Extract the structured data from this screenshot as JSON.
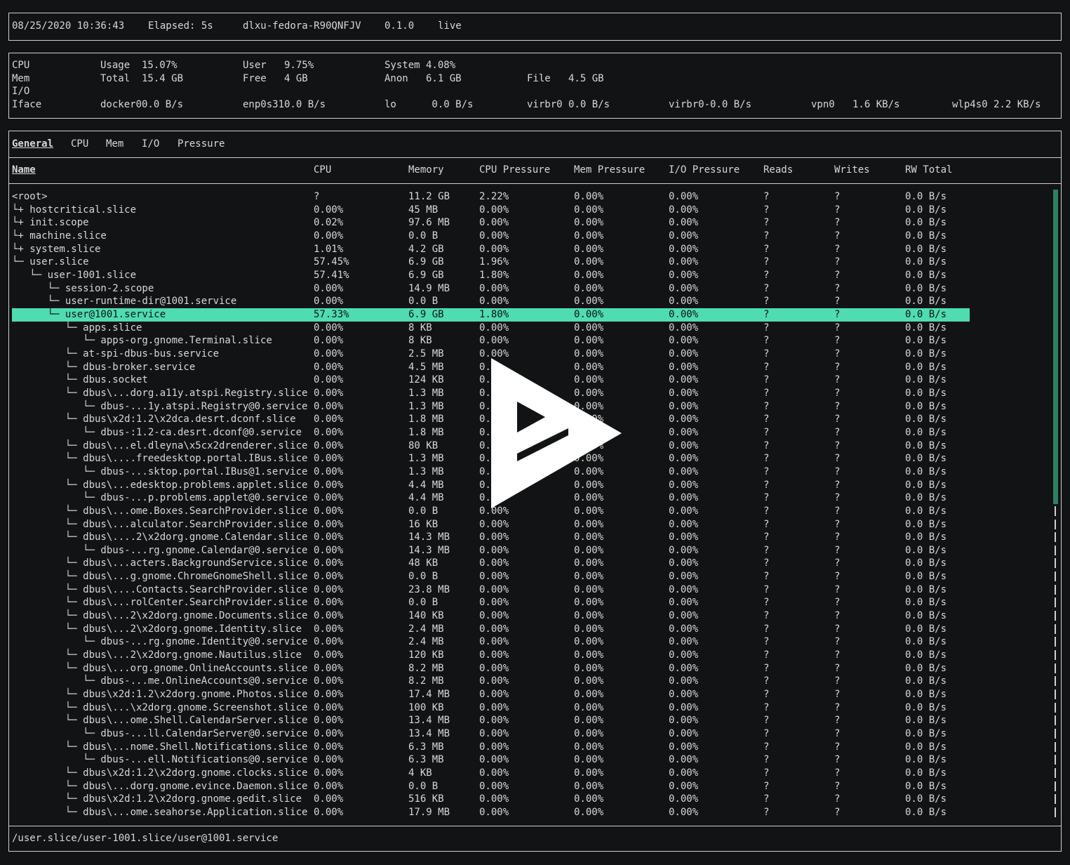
{
  "header": {
    "datetime": "08/25/2020 10:36:43",
    "elapsed": "Elapsed: 5s",
    "hostname": "dlxu-fedora-R90QNFJV",
    "version": "0.1.0",
    "mode": "live"
  },
  "system": {
    "cpu_label": "CPU",
    "cpu_usage": "Usage  15.07%",
    "cpu_user": "User   9.75%",
    "cpu_system": "System 4.08%",
    "mem_label": "Mem",
    "mem_total": "Total  15.4 GB",
    "mem_free": "Free   4 GB",
    "mem_anon": "Anon   6.1 GB",
    "mem_file": "File   4.5 GB",
    "io_label": "I/O",
    "iface_label": "Iface",
    "ifaces": [
      "docker00.0 B/s",
      "enp0s310.0 B/s",
      "lo      0.0 B/s",
      "virbr0 0.0 B/s",
      "virbr0-0.0 B/s",
      "vpn0   1.6 KB/s",
      "wlp4s0 2.2 KB/s"
    ]
  },
  "tabs": [
    "General",
    "CPU",
    "Mem",
    "I/O",
    "Pressure"
  ],
  "columns": [
    "Name",
    "CPU",
    "Memory",
    "CPU Pressure",
    "Mem Pressure",
    "I/O Pressure",
    "Reads",
    "Writes",
    "RW Total"
  ],
  "rows": [
    [
      "<root>",
      "?",
      "11.2 GB",
      "2.22%",
      "0.00%",
      "0.00%",
      "?",
      "?",
      "0.0 B/s"
    ],
    [
      "└+ hostcritical.slice",
      "0.00%",
      "45 MB",
      "0.00%",
      "0.00%",
      "0.00%",
      "?",
      "?",
      "0.0 B/s"
    ],
    [
      "└+ init.scope",
      "0.02%",
      "97.6 MB",
      "0.00%",
      "0.00%",
      "0.00%",
      "?",
      "?",
      "0.0 B/s"
    ],
    [
      "└+ machine.slice",
      "0.00%",
      "0.0 B",
      "0.00%",
      "0.00%",
      "0.00%",
      "?",
      "?",
      "0.0 B/s"
    ],
    [
      "└+ system.slice",
      "1.01%",
      "4.2 GB",
      "0.00%",
      "0.00%",
      "0.00%",
      "?",
      "?",
      "0.0 B/s"
    ],
    [
      "└─ user.slice",
      "57.45%",
      "6.9 GB",
      "1.96%",
      "0.00%",
      "0.00%",
      "?",
      "?",
      "0.0 B/s"
    ],
    [
      "   └─ user-1001.slice",
      "57.41%",
      "6.9 GB",
      "1.80%",
      "0.00%",
      "0.00%",
      "?",
      "?",
      "0.0 B/s"
    ],
    [
      "      └─ session-2.scope",
      "0.00%",
      "14.9 MB",
      "0.00%",
      "0.00%",
      "0.00%",
      "?",
      "?",
      "0.0 B/s"
    ],
    [
      "      └─ user-runtime-dir@1001.service",
      "0.00%",
      "0.0 B",
      "0.00%",
      "0.00%",
      "0.00%",
      "?",
      "?",
      "0.0 B/s"
    ],
    [
      "      └─ user@1001.service",
      "57.33%",
      "6.9 GB",
      "1.80%",
      "0.00%",
      "0.00%",
      "?",
      "?",
      "0.0 B/s"
    ],
    [
      "         └─ apps.slice",
      "0.00%",
      "8 KB",
      "0.00%",
      "0.00%",
      "0.00%",
      "?",
      "?",
      "0.0 B/s"
    ],
    [
      "            └─ apps-org.gnome.Terminal.slice",
      "0.00%",
      "8 KB",
      "0.00%",
      "0.00%",
      "0.00%",
      "?",
      "?",
      "0.0 B/s"
    ],
    [
      "         └─ at-spi-dbus-bus.service",
      "0.00%",
      "2.5 MB",
      "0.00%",
      "0.00%",
      "0.00%",
      "?",
      "?",
      "0.0 B/s"
    ],
    [
      "         └─ dbus-broker.service",
      "0.00%",
      "4.5 MB",
      "0.",
      "0.00%",
      "0.00%",
      "?",
      "?",
      "0.0 B/s"
    ],
    [
      "         └─ dbus.socket",
      "0.00%",
      "124 KB",
      "0.",
      "0.00%",
      "0.00%",
      "?",
      "?",
      "0.0 B/s"
    ],
    [
      "         └─ dbus\\...dorg.a11y.atspi.Registry.slice",
      "0.00%",
      "1.3 MB",
      "0.",
      "0.00%",
      "0.00%",
      "?",
      "?",
      "0.0 B/s"
    ],
    [
      "            └─ dbus-...1y.atspi.Registry@0.service",
      "0.00%",
      "1.3 MB",
      "0.",
      "0.00%",
      "0.00%",
      "?",
      "?",
      "0.0 B/s"
    ],
    [
      "         └─ dbus\\x2d:1.2\\x2dca.desrt.dconf.slice",
      "0.00%",
      "1.8 MB",
      "0.",
      "0.00%",
      "0.00%",
      "?",
      "?",
      "0.0 B/s"
    ],
    [
      "            └─ dbus-:1.2-ca.desrt.dconf@0.service",
      "0.00%",
      "1.8 MB",
      "0.",
      "0.00%",
      "0.00%",
      "?",
      "?",
      "0.0 B/s"
    ],
    [
      "         └─ dbus\\...el.dleyna\\x5cx2drenderer.slice",
      "0.00%",
      "80 KB",
      "0.",
      "0.00%",
      "0.00%",
      "?",
      "?",
      "0.0 B/s"
    ],
    [
      "         └─ dbus\\....freedesktop.portal.IBus.slice",
      "0.00%",
      "1.3 MB",
      "0.",
      "0.00%",
      "0.00%",
      "?",
      "?",
      "0.0 B/s"
    ],
    [
      "            └─ dbus-...sktop.portal.IBus@1.service",
      "0.00%",
      "1.3 MB",
      "0.",
      "0.00%",
      "0.00%",
      "?",
      "?",
      "0.0 B/s"
    ],
    [
      "         └─ dbus\\...edesktop.problems.applet.slice",
      "0.00%",
      "4.4 MB",
      "0.",
      "0.00%",
      "0.00%",
      "?",
      "?",
      "0.0 B/s"
    ],
    [
      "            └─ dbus-...p.problems.applet@0.service",
      "0.00%",
      "4.4 MB",
      "0.",
      "0.00%",
      "0.00%",
      "?",
      "?",
      "0.0 B/s"
    ],
    [
      "         └─ dbus\\...ome.Boxes.SearchProvider.slice",
      "0.00%",
      "0.0 B",
      "0.00%",
      "0.00%",
      "0.00%",
      "?",
      "?",
      "0.0 B/s"
    ],
    [
      "         └─ dbus\\...alculator.SearchProvider.slice",
      "0.00%",
      "16 KB",
      "0.00%",
      "0.00%",
      "0.00%",
      "?",
      "?",
      "0.0 B/s"
    ],
    [
      "         └─ dbus\\....2\\x2dorg.gnome.Calendar.slice",
      "0.00%",
      "14.3 MB",
      "0.00%",
      "0.00%",
      "0.00%",
      "?",
      "?",
      "0.0 B/s"
    ],
    [
      "            └─ dbus-...rg.gnome.Calendar@0.service",
      "0.00%",
      "14.3 MB",
      "0.00%",
      "0.00%",
      "0.00%",
      "?",
      "?",
      "0.0 B/s"
    ],
    [
      "         └─ dbus\\...acters.BackgroundService.slice",
      "0.00%",
      "48 KB",
      "0.00%",
      "0.00%",
      "0.00%",
      "?",
      "?",
      "0.0 B/s"
    ],
    [
      "         └─ dbus\\...g.gnome.ChromeGnomeShell.slice",
      "0.00%",
      "0.0 B",
      "0.00%",
      "0.00%",
      "0.00%",
      "?",
      "?",
      "0.0 B/s"
    ],
    [
      "         └─ dbus\\....Contacts.SearchProvider.slice",
      "0.00%",
      "23.8 MB",
      "0.00%",
      "0.00%",
      "0.00%",
      "?",
      "?",
      "0.0 B/s"
    ],
    [
      "         └─ dbus\\...rolCenter.SearchProvider.slice",
      "0.00%",
      "0.0 B",
      "0.00%",
      "0.00%",
      "0.00%",
      "?",
      "?",
      "0.0 B/s"
    ],
    [
      "         └─ dbus\\...2\\x2dorg.gnome.Documents.slice",
      "0.00%",
      "140 KB",
      "0.00%",
      "0.00%",
      "0.00%",
      "?",
      "?",
      "0.0 B/s"
    ],
    [
      "         └─ dbus\\...2\\x2dorg.gnome.Identity.slice",
      "0.00%",
      "2.4 MB",
      "0.00%",
      "0.00%",
      "0.00%",
      "?",
      "?",
      "0.0 B/s"
    ],
    [
      "            └─ dbus-...rg.gnome.Identity@0.service",
      "0.00%",
      "2.4 MB",
      "0.00%",
      "0.00%",
      "0.00%",
      "?",
      "?",
      "0.0 B/s"
    ],
    [
      "         └─ dbus\\...2\\x2dorg.gnome.Nautilus.slice",
      "0.00%",
      "120 KB",
      "0.00%",
      "0.00%",
      "0.00%",
      "?",
      "?",
      "0.0 B/s"
    ],
    [
      "         └─ dbus\\...org.gnome.OnlineAccounts.slice",
      "0.00%",
      "8.2 MB",
      "0.00%",
      "0.00%",
      "0.00%",
      "?",
      "?",
      "0.0 B/s"
    ],
    [
      "            └─ dbus-...me.OnlineAccounts@0.service",
      "0.00%",
      "8.2 MB",
      "0.00%",
      "0.00%",
      "0.00%",
      "?",
      "?",
      "0.0 B/s"
    ],
    [
      "         └─ dbus\\x2d:1.2\\x2dorg.gnome.Photos.slice",
      "0.00%",
      "17.4 MB",
      "0.00%",
      "0.00%",
      "0.00%",
      "?",
      "?",
      "0.0 B/s"
    ],
    [
      "         └─ dbus\\...\\x2dorg.gnome.Screenshot.slice",
      "0.00%",
      "100 KB",
      "0.00%",
      "0.00%",
      "0.00%",
      "?",
      "?",
      "0.0 B/s"
    ],
    [
      "         └─ dbus\\...ome.Shell.CalendarServer.slice",
      "0.00%",
      "13.4 MB",
      "0.00%",
      "0.00%",
      "0.00%",
      "?",
      "?",
      "0.0 B/s"
    ],
    [
      "            └─ dbus-...ll.CalendarServer@0.service",
      "0.00%",
      "13.4 MB",
      "0.00%",
      "0.00%",
      "0.00%",
      "?",
      "?",
      "0.0 B/s"
    ],
    [
      "         └─ dbus\\...nome.Shell.Notifications.slice",
      "0.00%",
      "6.3 MB",
      "0.00%",
      "0.00%",
      "0.00%",
      "?",
      "?",
      "0.0 B/s"
    ],
    [
      "            └─ dbus-...ell.Notifications@0.service",
      "0.00%",
      "6.3 MB",
      "0.00%",
      "0.00%",
      "0.00%",
      "?",
      "?",
      "0.0 B/s"
    ],
    [
      "         └─ dbus\\x2d:1.2\\x2dorg.gnome.clocks.slice",
      "0.00%",
      "4 KB",
      "0.00%",
      "0.00%",
      "0.00%",
      "?",
      "?",
      "0.0 B/s"
    ],
    [
      "         └─ dbus\\...dorg.gnome.evince.Daemon.slice",
      "0.00%",
      "0.0 B",
      "0.00%",
      "0.00%",
      "0.00%",
      "?",
      "?",
      "0.0 B/s"
    ],
    [
      "         └─ dbus\\x2d:1.2\\x2dorg.gnome.gedit.slice",
      "0.00%",
      "516 KB",
      "0.00%",
      "0.00%",
      "0.00%",
      "?",
      "?",
      "0.0 B/s"
    ],
    [
      "         └─ dbus\\...ome.seahorse.Application.slice",
      "0.00%",
      "17.9 MB",
      "0.00%",
      "0.00%",
      "0.00%",
      "?",
      "?",
      "0.0 B/s"
    ]
  ],
  "selected_row": 9,
  "status_path": "/user.slice/user-1001.slice/user@1001.service",
  "colors": {
    "selection": "#4fdcb0",
    "scrollbar": "#2f7f63",
    "background": "#121314"
  },
  "icons": {
    "overlay": "play-icon"
  }
}
